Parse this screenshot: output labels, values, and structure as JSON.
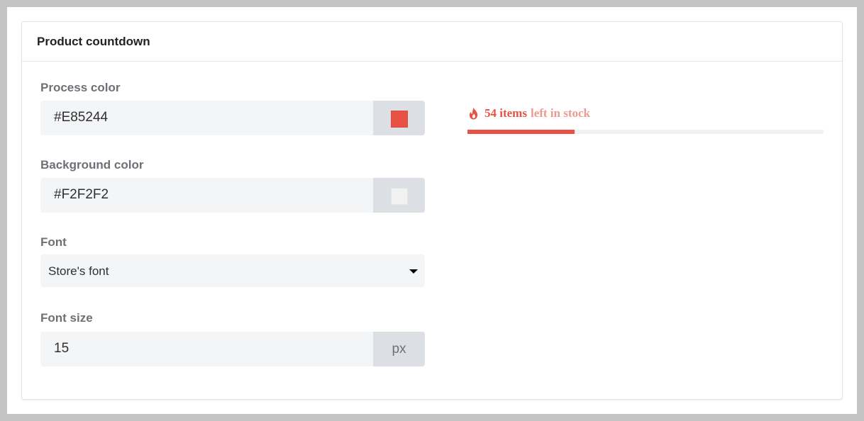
{
  "card": {
    "title": "Product countdown"
  },
  "process_color": {
    "label": "Process color",
    "value": "#E85244",
    "swatch": "#E85244"
  },
  "background_color": {
    "label": "Background color",
    "value": "#F2F2F2",
    "swatch": "#F2F2F2"
  },
  "font": {
    "label": "Font",
    "selected": "Store's font"
  },
  "font_size": {
    "label": "Font size",
    "value": "15",
    "unit": "px"
  },
  "preview": {
    "count_text": "54 items",
    "suffix_text": "left in stock",
    "progress_fraction": 0.3,
    "accent": "#E85244",
    "accent_light": "#EE9A92",
    "track": "#F2F2F2",
    "icon": "fire-icon"
  }
}
